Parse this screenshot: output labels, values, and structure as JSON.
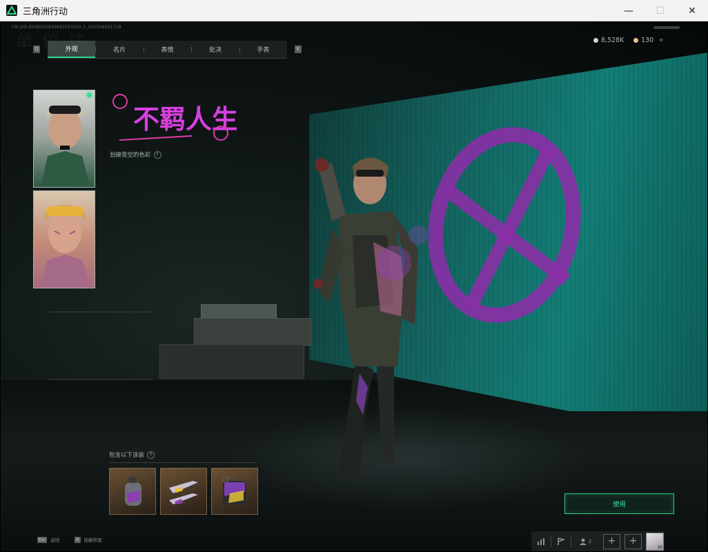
{
  "window": {
    "title": "三角洲行动",
    "minimize_glyph": "—",
    "maximize_glyph": "☐",
    "close_glyph": "✕"
  },
  "top": {
    "uid_text": "CN UID:9048505939841053292 2_202509261738",
    "tab_key_left": "Q",
    "tab_key_right": "E",
    "tabs": [
      {
        "label": "外观",
        "active": true
      },
      {
        "label": "名片",
        "active": false
      },
      {
        "label": "表情",
        "active": false
      },
      {
        "label": "处决",
        "active": false
      },
      {
        "label": "手表",
        "active": false
      }
    ],
    "currency": [
      {
        "value": "8,528K",
        "icon": "silver-coin-icon",
        "color": "#cfd6d4"
      },
      {
        "value": "130",
        "icon": "gold-coin-icon",
        "color": "#e6c58a",
        "add_glyph": "+"
      }
    ]
  },
  "skin": {
    "title": "不羁人生",
    "description": "划破夜空的色彩",
    "help_glyph": "?"
  },
  "contents": {
    "label": "包含以下涂装",
    "help_glyph": "?",
    "items": [
      {
        "icon": "grenade-skin-icon"
      },
      {
        "icon": "knife-skin-icon"
      },
      {
        "icon": "case-skin-icon"
      }
    ]
  },
  "use_button": {
    "label": "使用"
  },
  "bottom": {
    "hints": [
      {
        "key": "Esc",
        "label": "返回"
      },
      {
        "key": "H",
        "label": "隐藏界面"
      }
    ],
    "friend_count": "2",
    "plus_glyph": "+",
    "avatar_level": "30"
  },
  "colors": {
    "accent": "#2fd58a",
    "screen": "#137e77",
    "spray": "#8a2fa6"
  }
}
